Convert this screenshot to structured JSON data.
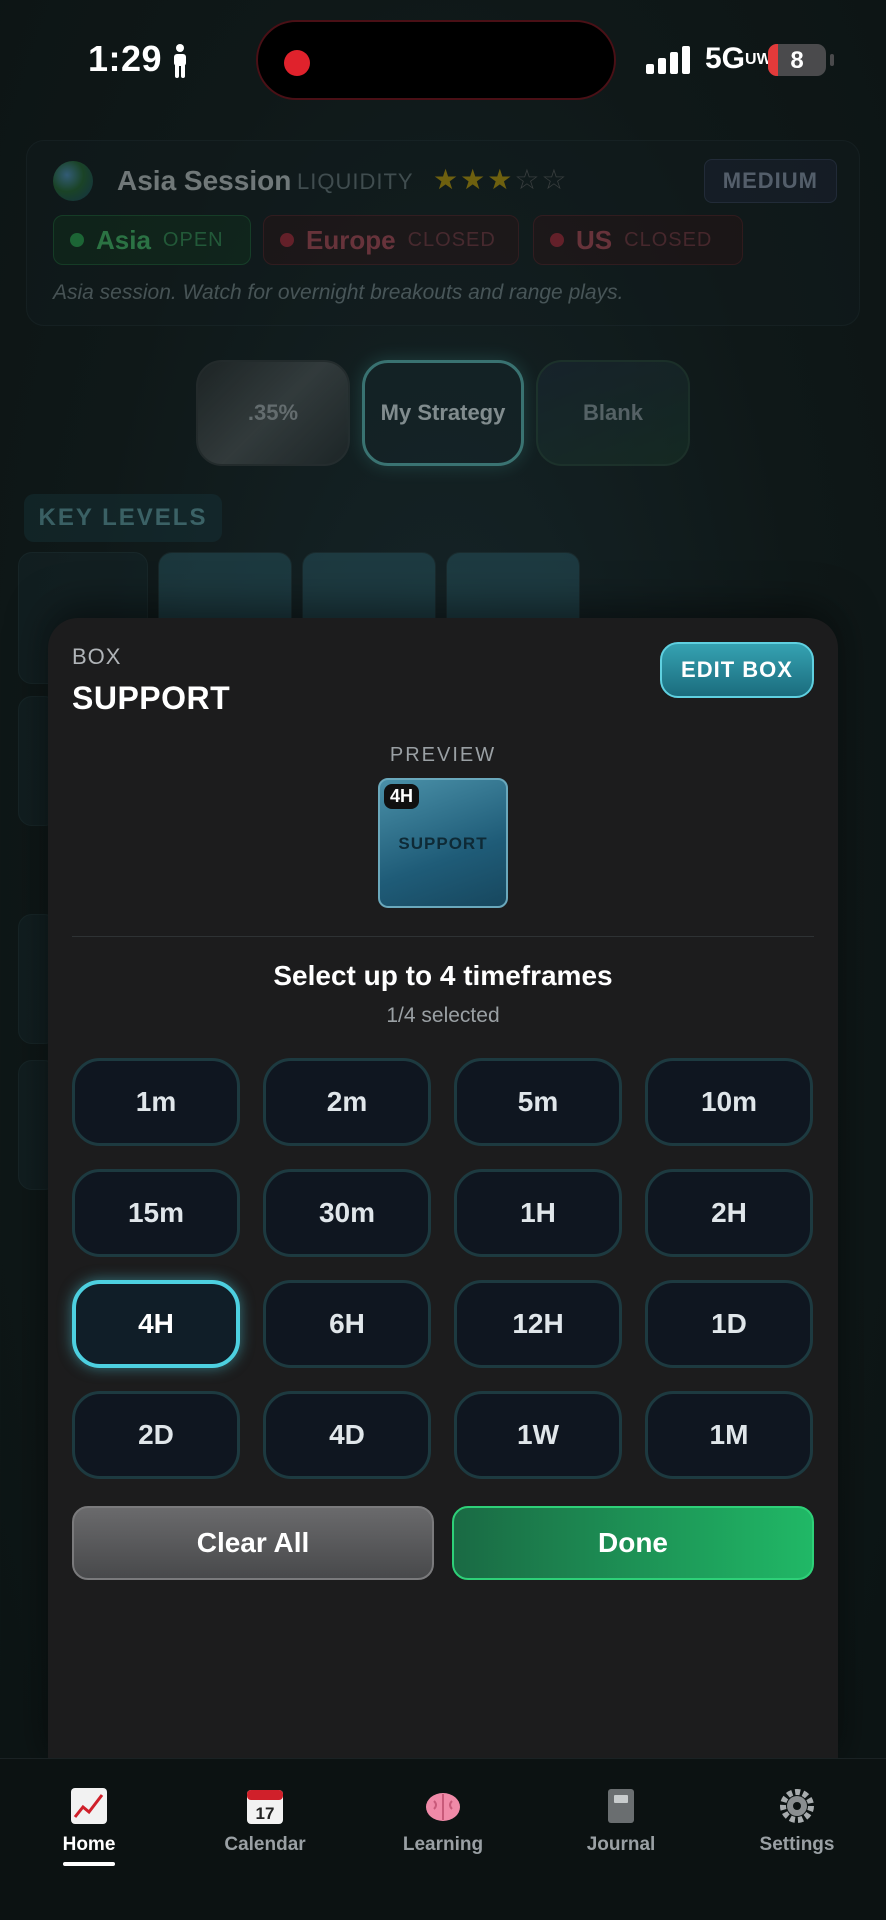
{
  "status_bar": {
    "time": "1:29",
    "network": "5G",
    "network_suffix": "UW",
    "battery": "8"
  },
  "session": {
    "title": "Asia Session",
    "liquidity_label": "LIQUIDITY",
    "stars_filled": "★★★",
    "stars_empty": "☆☆",
    "level_badge": "MEDIUM",
    "markets": [
      {
        "name": "Asia",
        "state": "OPEN"
      },
      {
        "name": "Europe",
        "state": "CLOSED"
      },
      {
        "name": "US",
        "state": "CLOSED"
      }
    ],
    "note": "Asia session. Watch for overnight breakouts and range plays."
  },
  "strategies": [
    {
      "label": ".35%"
    },
    {
      "label": "My Strategy"
    },
    {
      "label": "Blank"
    }
  ],
  "background": {
    "key_levels": "KEY LEVELS"
  },
  "sheet": {
    "box_label": "BOX",
    "box_title": "SUPPORT",
    "edit_button": "EDIT BOX",
    "preview_label": "PREVIEW",
    "preview_timeframe": "4H",
    "preview_name": "SUPPORT",
    "select_title": "Select up to 4 timeframes",
    "select_count": "1/4 selected",
    "timeframes": [
      "1m",
      "2m",
      "5m",
      "10m",
      "15m",
      "30m",
      "1H",
      "2H",
      "4H",
      "6H",
      "12H",
      "1D",
      "2D",
      "4D",
      "1W",
      "1M"
    ],
    "selected_timeframes": [
      "4H"
    ],
    "clear_button": "Clear All",
    "done_button": "Done"
  },
  "tabbar": {
    "items": [
      {
        "label": "Home",
        "icon": "chart-icon"
      },
      {
        "label": "Calendar",
        "icon": "calendar-icon"
      },
      {
        "label": "Learning",
        "icon": "brain-icon"
      },
      {
        "label": "Journal",
        "icon": "journal-icon"
      },
      {
        "label": "Settings",
        "icon": "gear-icon"
      }
    ],
    "active": "Home",
    "calendar_day": "17"
  }
}
